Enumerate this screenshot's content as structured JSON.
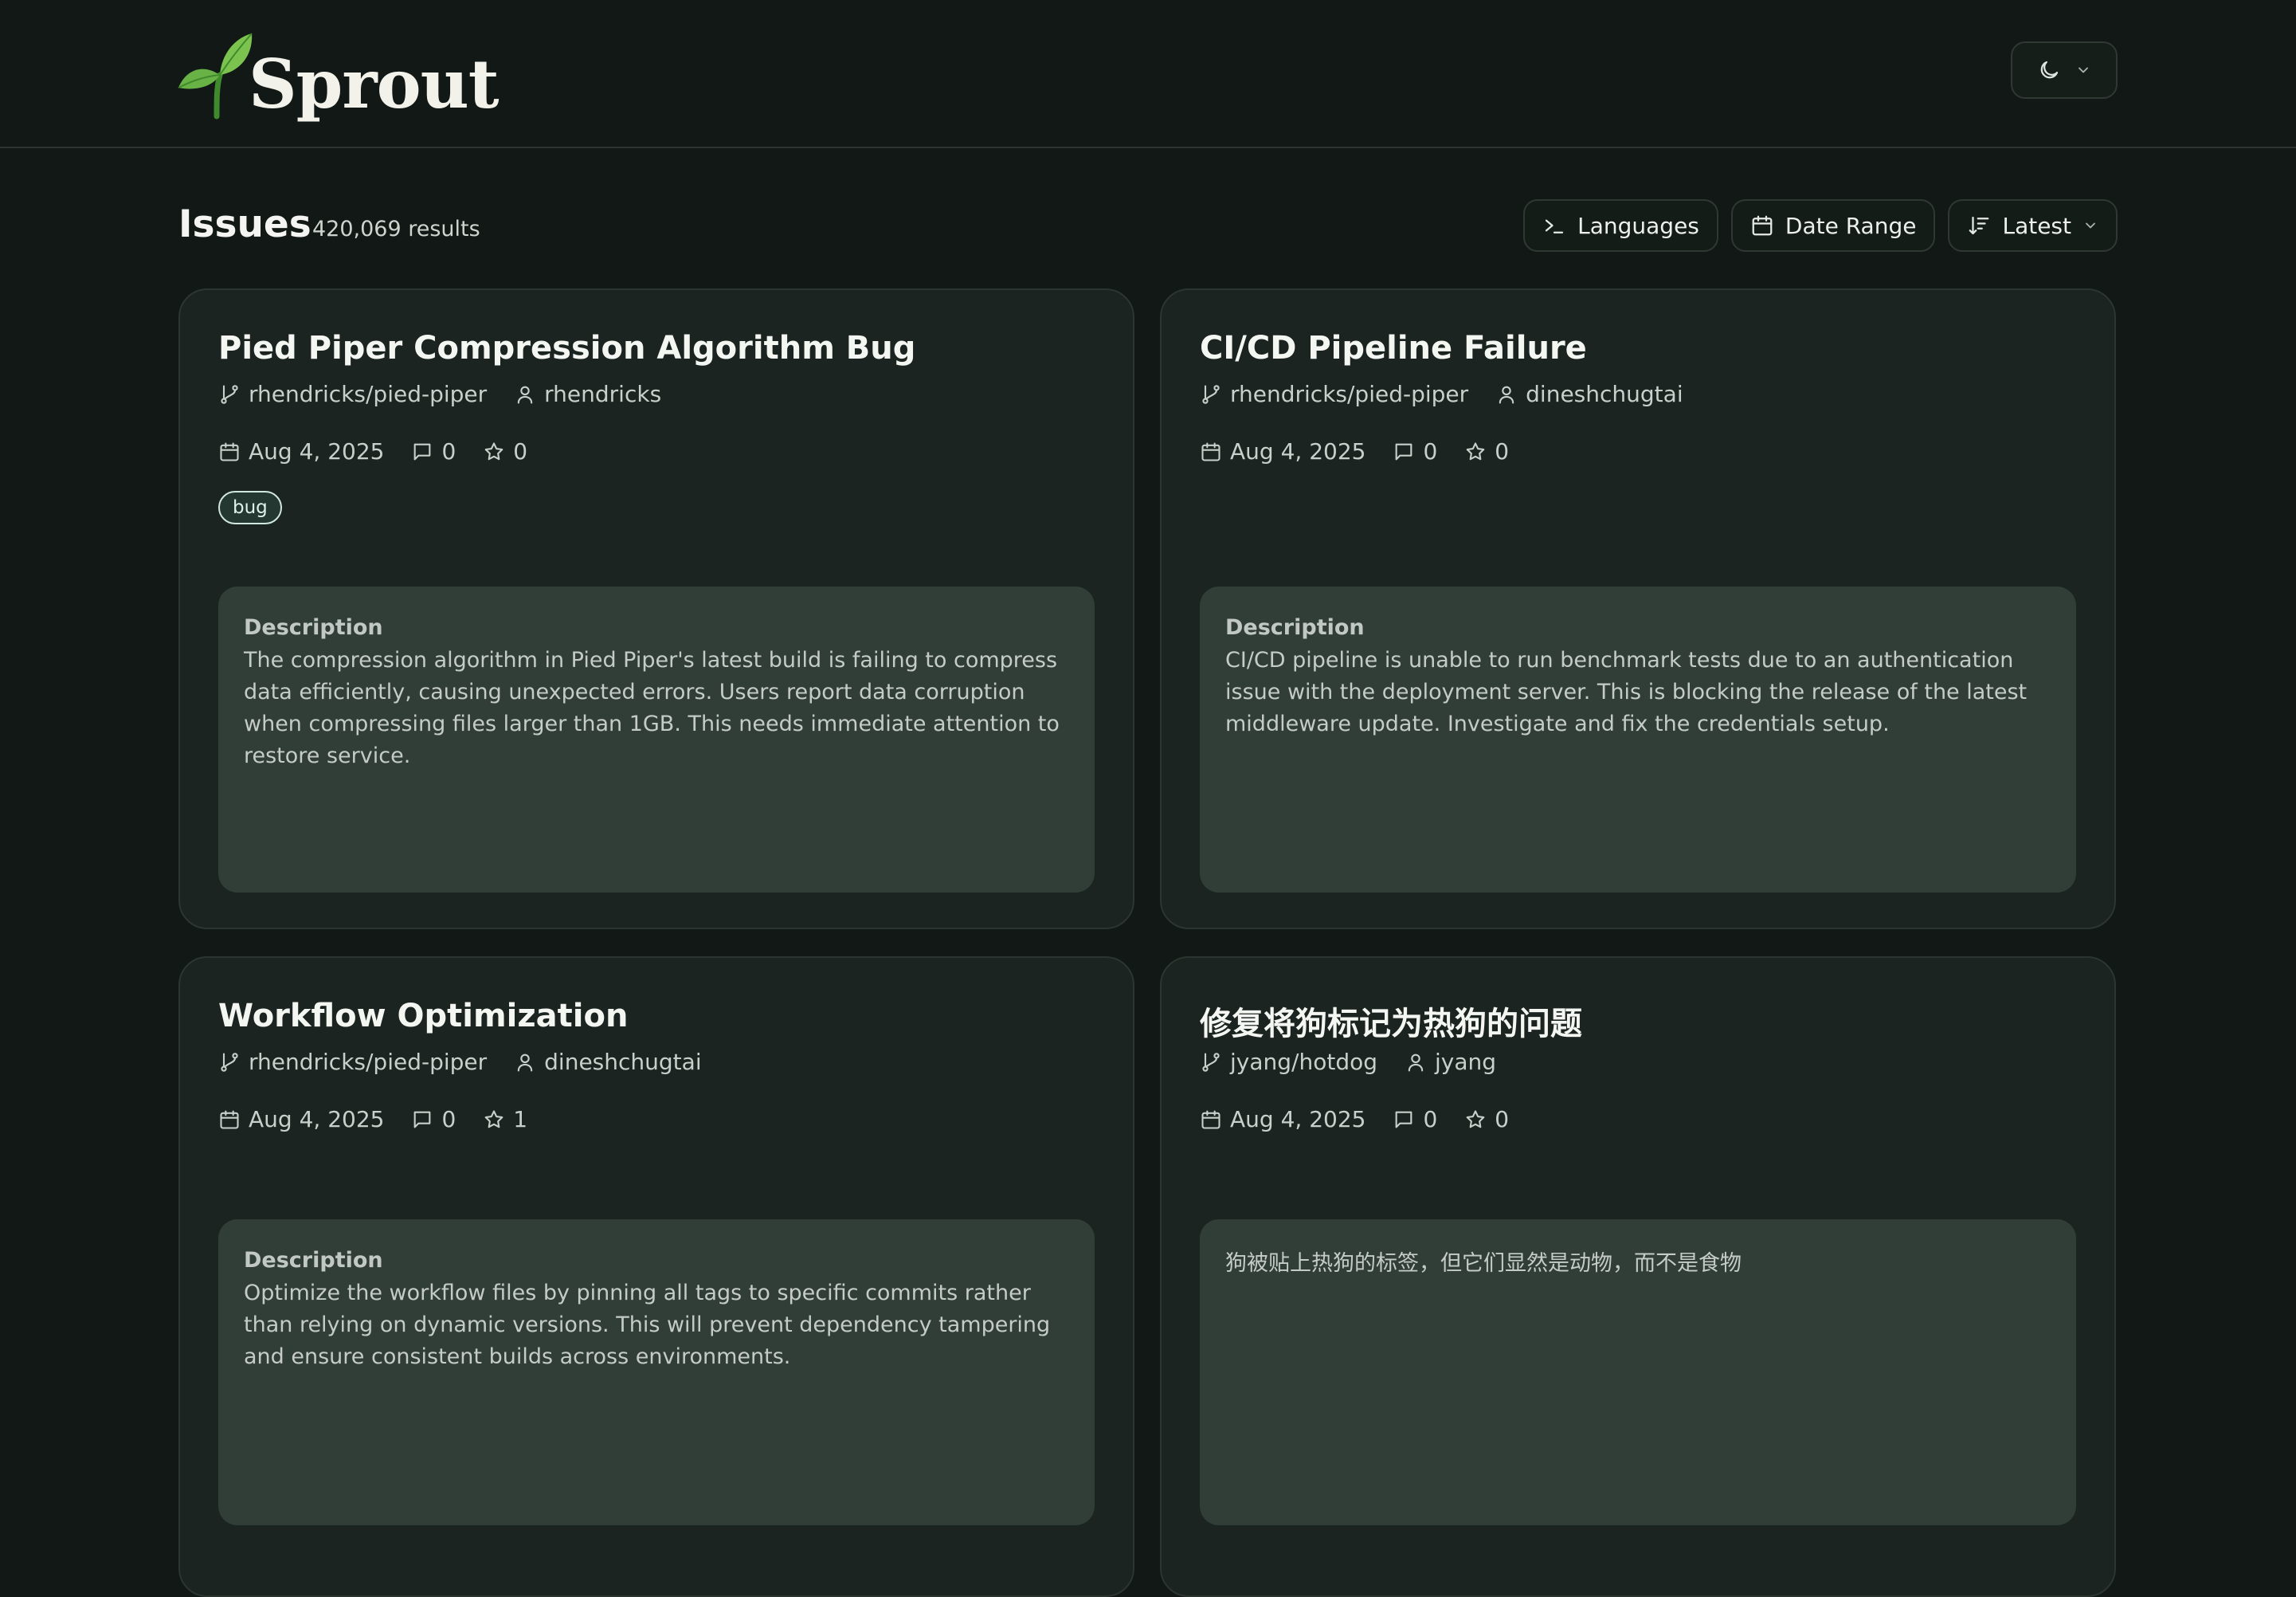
{
  "header": {
    "brand": "Sprout",
    "theme_toggle": {
      "icon": "moon-icon",
      "dropdown_icon": "chevron-down-icon"
    }
  },
  "toolbar": {
    "title": "Issues",
    "result_count": "420,069 results",
    "filters": [
      {
        "label": "Languages",
        "icon": "terminal-icon"
      },
      {
        "label": "Date Range",
        "icon": "calendar-icon"
      },
      {
        "label": "Latest",
        "icon": "sort-icon",
        "dropdown_icon": "chevron-down-icon"
      }
    ]
  },
  "issues": [
    {
      "title": "Pied Piper Compression Algorithm Bug",
      "repo": "rhendricks/pied-piper",
      "author": "rhendricks",
      "date": "Aug 4, 2025",
      "comments": "0",
      "stars": "0",
      "tag": "bug",
      "description_label": "Description",
      "description": "The compression algorithm in Pied Piper's latest build is failing to compress data efficiently, causing unexpected errors. Users report data corruption when compressing files larger than 1GB. This needs immediate attention to restore service."
    },
    {
      "title": "CI/CD Pipeline Failure",
      "repo": "rhendricks/pied-piper",
      "author": "dineshchugtai",
      "date": "Aug 4, 2025",
      "comments": "0",
      "stars": "0",
      "description_label": "Description",
      "description": "CI/CD pipeline is unable to run benchmark tests due to an authentication issue with the deployment server. This is blocking the release of the latest middleware update. Investigate and fix the credentials setup."
    },
    {
      "title": "Workflow Optimization",
      "repo": "rhendricks/pied-piper",
      "author": "dineshchugtai",
      "date": "Aug 4, 2025",
      "comments": "0",
      "stars": "1",
      "description_label": "Description",
      "description": "Optimize the workflow files by pinning all tags to specific commits rather than relying on dynamic versions. This will prevent dependency tampering and ensure consistent builds across environments."
    },
    {
      "title": "修复将狗标记为热狗的问题",
      "repo": "jyang/hotdog",
      "author": "jyang",
      "date": "Aug 4, 2025",
      "comments": "0",
      "stars": "0",
      "description": "狗被贴上热狗的标签，但它们显然是动物，而不是食物"
    }
  ],
  "colors": {
    "background": "#111815",
    "card": "#1b2420",
    "description_panel": "#313e37",
    "brand_green": "#5aa640"
  }
}
